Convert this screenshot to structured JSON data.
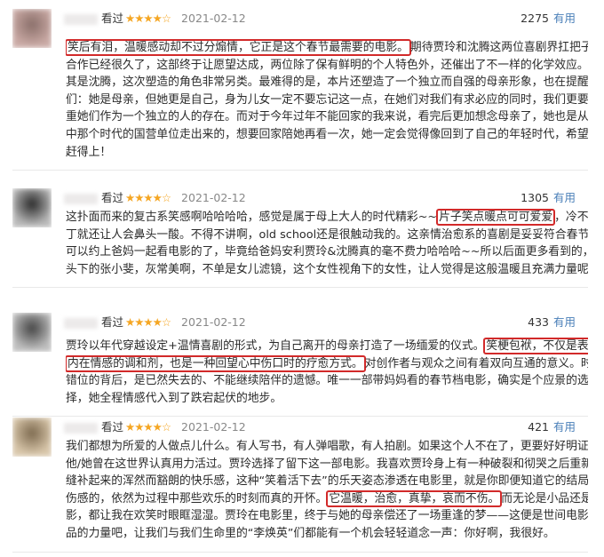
{
  "reviews": [
    {
      "watched": "看过",
      "stars": "★★★★☆",
      "date": "2021-02-12",
      "votes": "2275",
      "vote_label": "有用",
      "avatar_colors": [
        "#c9a9a4",
        "#8a6f6a"
      ],
      "lines": [
        [
          "",
          "笑后有泪，温暖感动却不过分煽情，它正是这个春节最需要的电影。",
          "期待贾玲和沈腾这两位喜剧界扛把子的"
        ],
        [
          "合作已经很久了，这部终于让愿望达成，两位除了保有鲜明的个人特色外，还催出了不一样的化学效应。尤"
        ],
        [
          "其是沈腾，这次塑造的角色非常另类。最难得的是，本片还塑造了一个独立而自强的母亲形象，也在提醒我"
        ],
        [
          "们：她是母亲，但她更是自己，身为儿女一定不要忘记这一点，在她们对我们有求必应的同时，我们更要尊"
        ],
        [
          "重她们作为一个独立的人的存在。而对于今年过年不能回家的我来说，看完后更加想念母亲了，她也是从片"
        ],
        [
          "中那个时代的国营单位走出来的，想要回家陪她再看一次，她一定会觉得像回到了自己的年轻时代，希望还能"
        ],
        [
          "赶得上！"
        ]
      ]
    },
    {
      "watched": "看过",
      "stars": "★★★★☆",
      "date": "2021-02-12",
      "votes": "1305",
      "vote_label": "有用",
      "avatar_colors": [
        "#b8b8b8",
        "#2a2a2a"
      ],
      "lines": [
        [
          "这扑面而来的复古系笑感啊哈哈哈哈，感觉是属于母上大人的时代精彩~~",
          "片子笑点暖点可可爱爱",
          "，冷不"
        ],
        [
          "丁就还让人会鼻头一酸。不得不讲啊，old school还是很触动我的。这亲情治愈系的喜剧是妥妥符合春节档"
        ],
        [
          "可以约上爸妈一起看电影的了，毕竟给爸妈安利贾玲&沈腾真的毫不费力哈哈哈~~所以后面更多看到的，贾玲镜"
        ],
        [
          "头下的张小斐，灰常美啊，不单是女儿滤镜，这个女性视角下的女性，让人觉得是这般温暖且充满力量呢"
        ]
      ]
    },
    {
      "watched": "看过",
      "stars": "★★★★☆",
      "date": "2021-02-12",
      "votes": "433",
      "vote_label": "有用",
      "avatar_colors": [
        "#bdbdbd",
        "#454545"
      ],
      "lines": [
        [
          "贾玲以年代穿越设定+温情喜剧的形式，为自己离开的母亲打造了一场缅爱的仪式。",
          "笑梗包袱，不仅是表任"
        ],
        [
          "",
          "内在情感的调和剂，也是一种回望心中伤口时的疗愈方式。",
          "对创作者与观众之间有着双向互通的意义。时空"
        ],
        [
          "错位的背后，是已然失去的、不能继续陪伴的遗憾。唯一一部带妈妈看的春节档电影，确实是个应景的选"
        ],
        [
          "择，她全程情感代入到了跌宕起伏的地步。"
        ]
      ]
    },
    {
      "watched": "看过",
      "stars": "★★★★☆",
      "date": "2021-02-12",
      "votes": "421",
      "vote_label": "有用",
      "avatar_colors": [
        "#d8c6aa",
        "#7d6a4f"
      ],
      "lines": [
        [
          "我们都想为所爱的人做点儿什么。有人写书，有人弹唱歌，有人拍剧。如果这个人不在了，更要好好明证"
        ],
        [
          "他/她曾在这世界认真用力活过。贾玲选择了留下这一部电影。我喜欢贾玲身上有一种破裂和彻哭之后重新"
        ],
        [
          "缝补起来的浑然而豁朗的快乐感，这种“笑着活下去”的乐天姿态渗透在电影里，就是你即便知道它的结局是"
        ],
        [
          "伤感的，依然为过程中那些欢乐的时刻而真的开怀。",
          "它温暖，治愈，真挚，哀而不伤。",
          "而无论是小品还是电"
        ],
        [
          "影，都让我在欢笑时眼眶湿湿。贾玲在电影里，终于与她的母亲偿还了一场重逢的梦——这便是世间电影作"
        ],
        [
          "品的力量吧，让我们与我们生命里的“李焕英”们都能有一个机会轻轻道念一声：你好啊，我很好。"
        ]
      ]
    }
  ]
}
